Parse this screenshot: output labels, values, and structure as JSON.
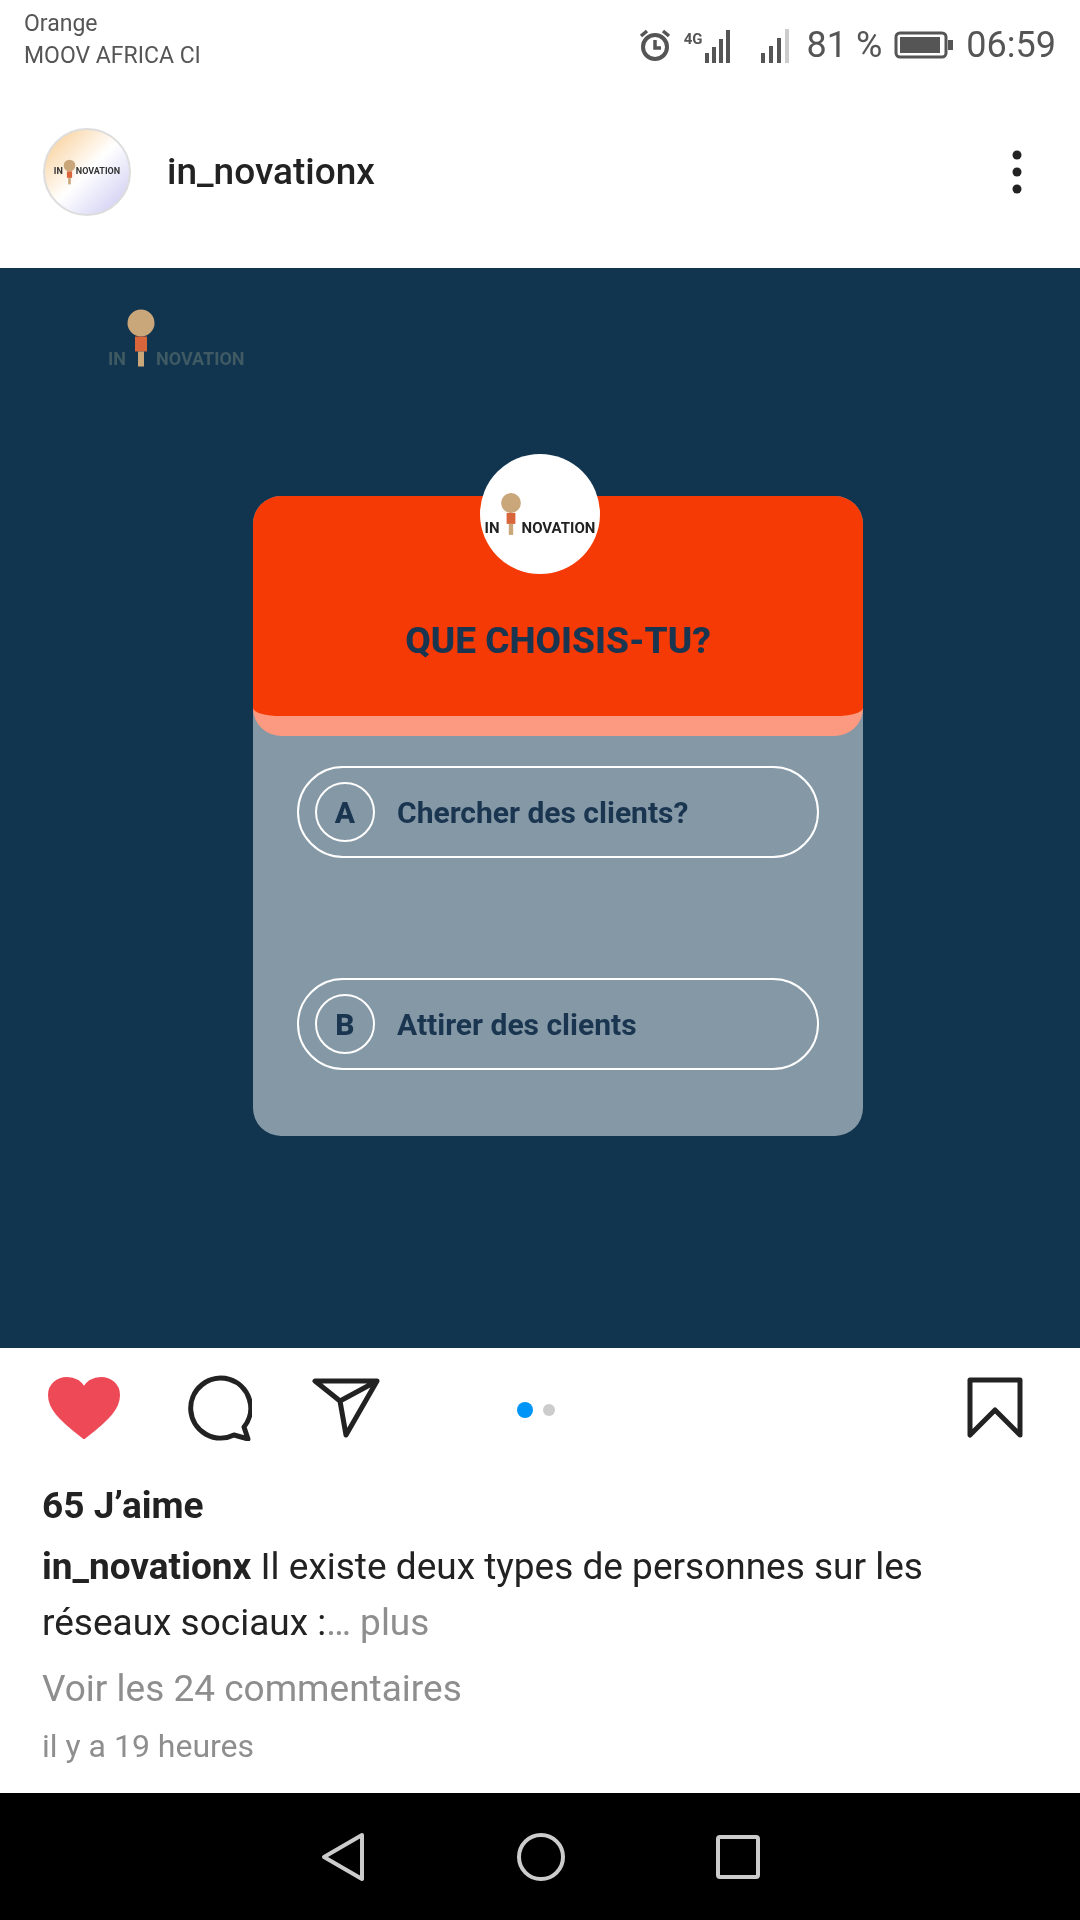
{
  "status_bar": {
    "carrier_lines": [
      "Orange",
      "MOOV AFRICA CI"
    ],
    "network": "4G",
    "battery": "81 %",
    "time": "06:59"
  },
  "post_header": {
    "username": "in_novationx",
    "avatar_logo": [
      "IN",
      "NOVATION"
    ]
  },
  "post_image": {
    "corner_logo": [
      "IN",
      "NOVATION"
    ],
    "badge_logo": [
      "IN",
      "NOVATION"
    ],
    "question": "QUE CHOISIS-TU?",
    "options": [
      {
        "letter": "A",
        "text": "Chercher des clients?"
      },
      {
        "letter": "B",
        "text": "Attirer des clients"
      }
    ]
  },
  "actions": {
    "liked": true,
    "carousel": [
      {
        "selected": true
      },
      {
        "selected": false
      }
    ]
  },
  "likes": "65 J’aime",
  "caption": {
    "username": "in_novationx",
    "text": "Il existe deux types de personnes sur les réseaux sociaux :",
    "more": "… plus"
  },
  "comments_link": "Voir les 24 commentaires",
  "time_ago": "il y a 19 heures"
}
